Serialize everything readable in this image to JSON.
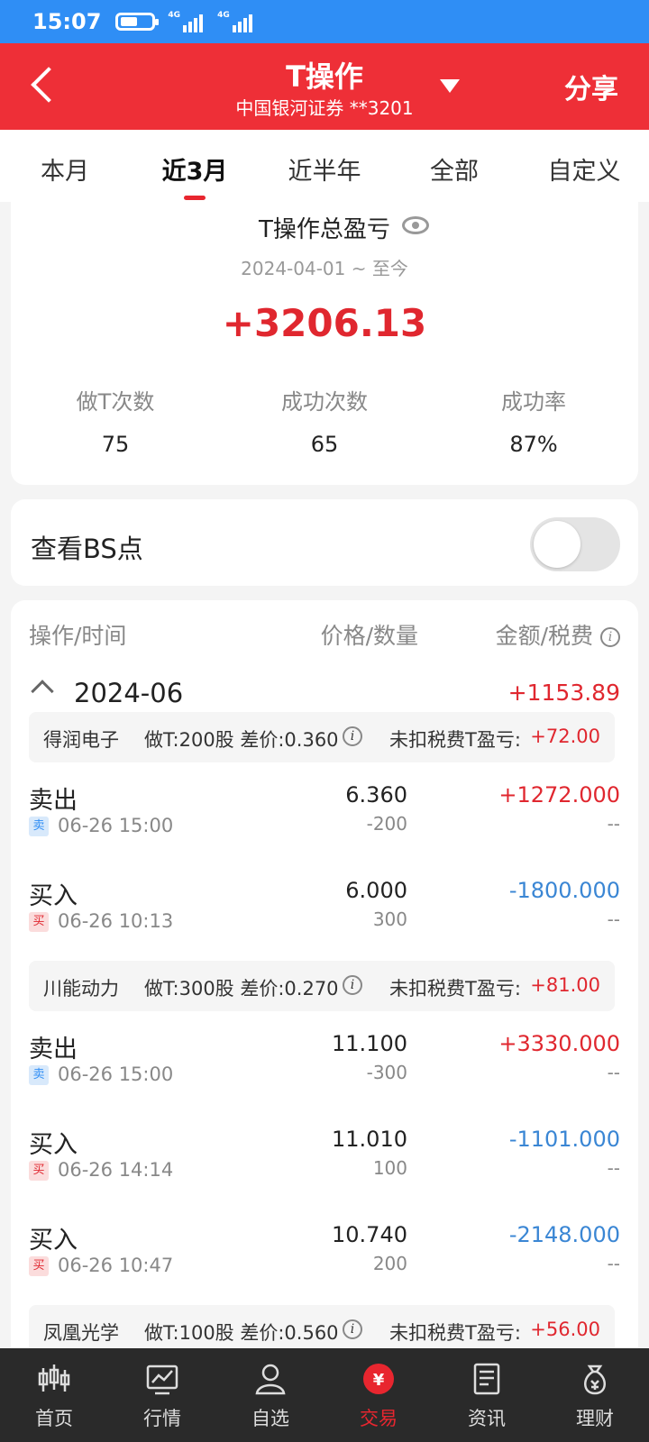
{
  "status": {
    "time": "15:07",
    "battery_level": 0.55,
    "net1": "4G",
    "net2": "4G"
  },
  "header": {
    "title": "T操作",
    "subtitle": "中国银河证券 **3201",
    "share": "分享"
  },
  "tabs": [
    {
      "label": "本月"
    },
    {
      "label": "近3月",
      "active": true
    },
    {
      "label": "近半年"
    },
    {
      "label": "全部"
    },
    {
      "label": "自定义"
    }
  ],
  "summary": {
    "title": "T操作总盈亏",
    "range": "2024-04-01 ~ 至今",
    "total": "+3206.13",
    "stats": [
      {
        "label": "做T次数",
        "value": "75"
      },
      {
        "label": "成功次数",
        "value": "65"
      },
      {
        "label": "成功率",
        "value": "87%"
      }
    ]
  },
  "bs_points": {
    "label": "查看BS点",
    "enabled": false
  },
  "records": {
    "columns": [
      "操作/时间",
      "价格/数量",
      "金额/税费"
    ],
    "month": {
      "label": "2024-06",
      "total": "+1153.89"
    },
    "groups": [
      {
        "name": "得润电子",
        "detail": "做T:200股 差价:0.360",
        "pl_label": "未扣税费T盈亏:",
        "pl_value": "+72.00",
        "trades": [
          {
            "action": "卖出",
            "side": "卖",
            "time": "06-26 15:00",
            "price": "6.360",
            "qty": "-200",
            "amount": "+1272.000",
            "fee": "--"
          },
          {
            "action": "买入",
            "side": "买",
            "time": "06-26 10:13",
            "price": "6.000",
            "qty": "300",
            "amount": "-1800.000",
            "fee": "--"
          }
        ]
      },
      {
        "name": "川能动力",
        "detail": "做T:300股 差价:0.270",
        "pl_label": "未扣税费T盈亏:",
        "pl_value": "+81.00",
        "trades": [
          {
            "action": "卖出",
            "side": "卖",
            "time": "06-26 15:00",
            "price": "11.100",
            "qty": "-300",
            "amount": "+3330.000",
            "fee": "--"
          },
          {
            "action": "买入",
            "side": "买",
            "time": "06-26 14:14",
            "price": "11.010",
            "qty": "100",
            "amount": "-1101.000",
            "fee": "--"
          },
          {
            "action": "买入",
            "side": "买",
            "time": "06-26 10:47",
            "price": "10.740",
            "qty": "200",
            "amount": "-2148.000",
            "fee": "--"
          }
        ]
      },
      {
        "name": "凤凰光学",
        "detail": "做T:100股 差价:0.560",
        "pl_label": "未扣税费T盈亏:",
        "pl_value": "+56.00",
        "trades": []
      }
    ]
  },
  "nav": [
    {
      "label": "首页",
      "icon": "candlestick-icon"
    },
    {
      "label": "行情",
      "icon": "chart-icon"
    },
    {
      "label": "自选",
      "icon": "person-icon"
    },
    {
      "label": "交易",
      "icon": "yuan-icon",
      "active": true
    },
    {
      "label": "资讯",
      "icon": "document-icon"
    },
    {
      "label": "理财",
      "icon": "money-bag-icon"
    }
  ],
  "colors": {
    "brand_red": "#ee2f37",
    "status_blue": "#2f8ef5",
    "profit": "#e0272f",
    "loss": "#3a86d4"
  }
}
